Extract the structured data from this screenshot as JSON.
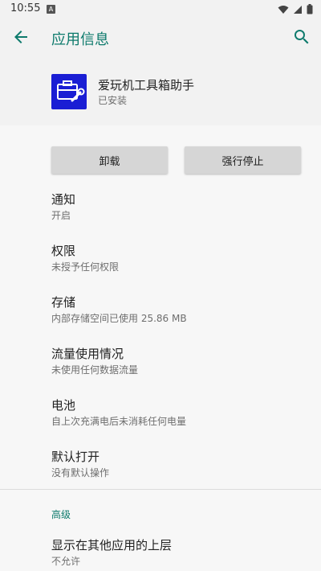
{
  "status_bar": {
    "time": "10:55",
    "notification_letter": "A"
  },
  "app_bar": {
    "title": "应用信息",
    "accent_color": "#0d7a6c"
  },
  "app": {
    "name": "爱玩机工具箱助手",
    "status": "已安装",
    "icon_color": "#1a1ed4"
  },
  "buttons": {
    "uninstall": "卸载",
    "force_stop": "强行停止"
  },
  "items": [
    {
      "title": "通知",
      "subtitle": "开启"
    },
    {
      "title": "权限",
      "subtitle": "未授予任何权限"
    },
    {
      "title": "存储",
      "subtitle": "内部存储空间已使用 25.86 MB"
    },
    {
      "title": "流量使用情况",
      "subtitle": "未使用任何数据流量"
    },
    {
      "title": "电池",
      "subtitle": "自上次充满电后未消耗任何电量"
    },
    {
      "title": "默认打开",
      "subtitle": "没有默认操作"
    }
  ],
  "advanced": {
    "header": "高级",
    "items": [
      {
        "title": "显示在其他应用的上层",
        "subtitle": "不允许"
      }
    ]
  }
}
